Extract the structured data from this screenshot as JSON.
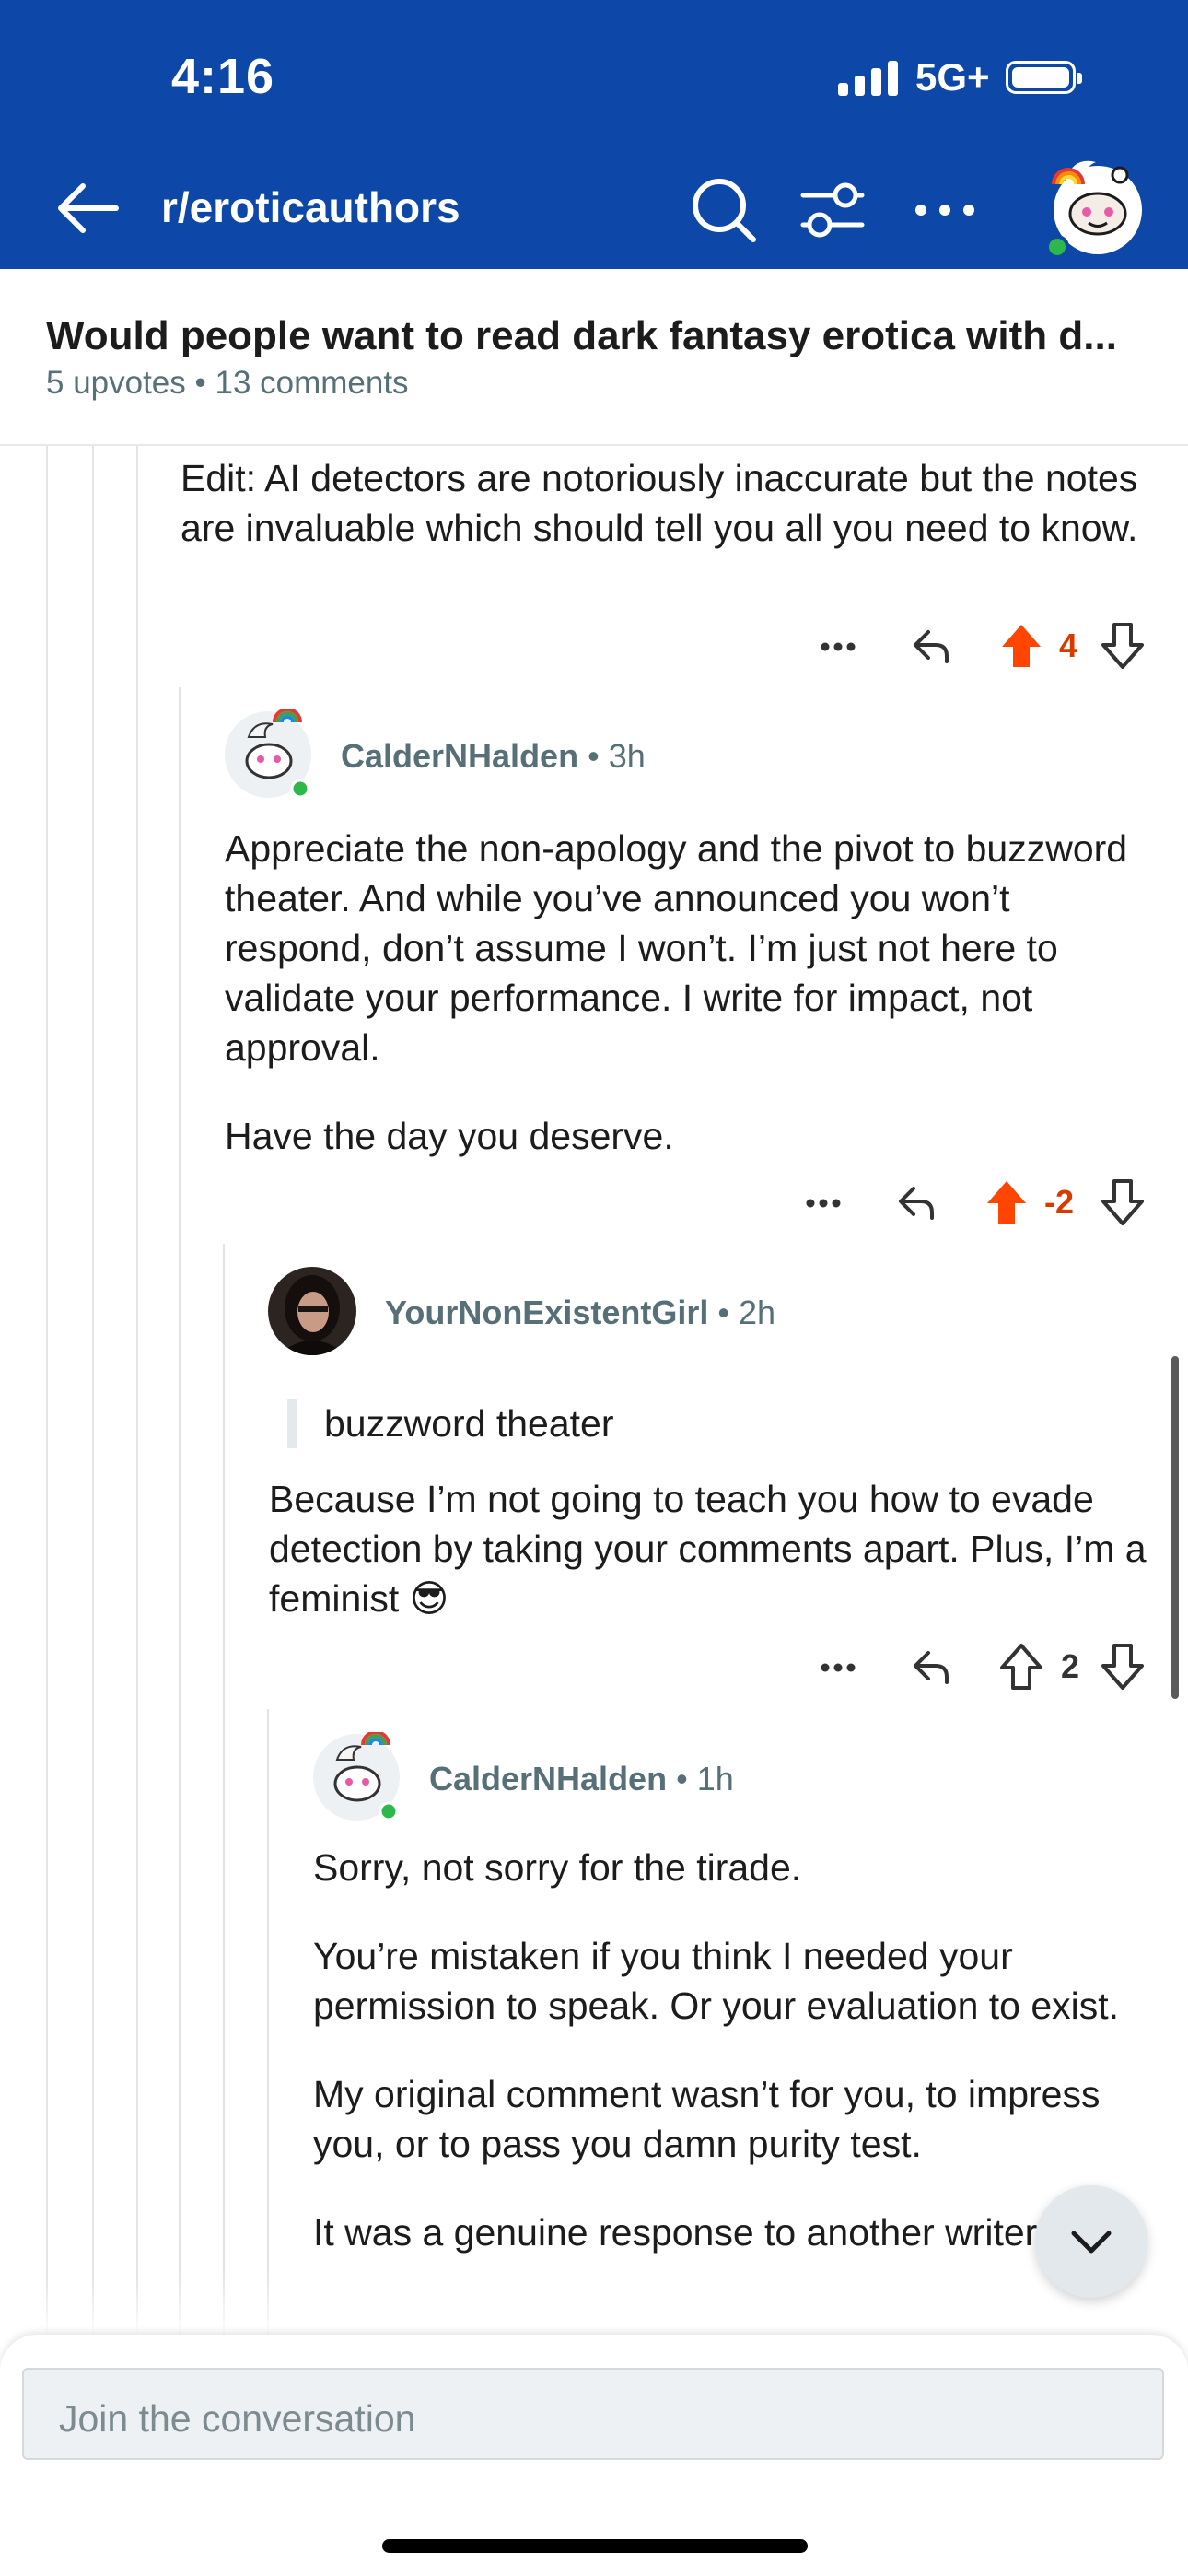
{
  "status": {
    "time": "4:16",
    "network": "5G+"
  },
  "header": {
    "subreddit": "r/eroticauthors",
    "icons": [
      "back-arrow-icon",
      "search-icon",
      "filter-icon",
      "more-icon",
      "snoo-avatar-icon"
    ]
  },
  "post": {
    "title": "Would people want to read dark fantasy erotica with d...",
    "meta": "5 upvotes • 13 comments"
  },
  "comments": [
    {
      "body": [
        "Edit: AI detectors are notoriously inaccurate but the notes are invaluable which should tell you all you need to know."
      ],
      "score": "4",
      "upvoted": true
    },
    {
      "author": "CalderNHalden",
      "age": "3h",
      "body": [
        "Appreciate the non-apology and the pivot to buzzword theater. And while you’ve announced you won’t respond, don’t assume I won’t. I’m just not here to validate your performance. I write for impact, not approval.",
        "Have the day you deserve."
      ],
      "score": "-2",
      "upvoted": true
    },
    {
      "author": "YourNonExistentGirl",
      "age": "2h",
      "quote": "buzzword theater",
      "body": [
        "Because I’m not going to teach you how to evade detection by taking your comments apart. Plus, I’m a feminist 😎"
      ],
      "score": "2",
      "upvoted": false
    },
    {
      "author": "CalderNHalden",
      "age": "1h",
      "body": [
        "Sorry, not sorry for the tirade.",
        "You’re mistaken if you think I needed your permission to speak. Or your evaluation to exist.",
        "My original comment wasn’t for you, to impress you, or to pass you damn purity test.",
        "It was a genuine response to another writer"
      ]
    }
  ],
  "composer": {
    "placeholder": "Join the conversation"
  },
  "colors": {
    "brand": "#0d47a8",
    "upvote": "#ff4500",
    "score_up": "#d93a00",
    "meta": "#576f76"
  }
}
